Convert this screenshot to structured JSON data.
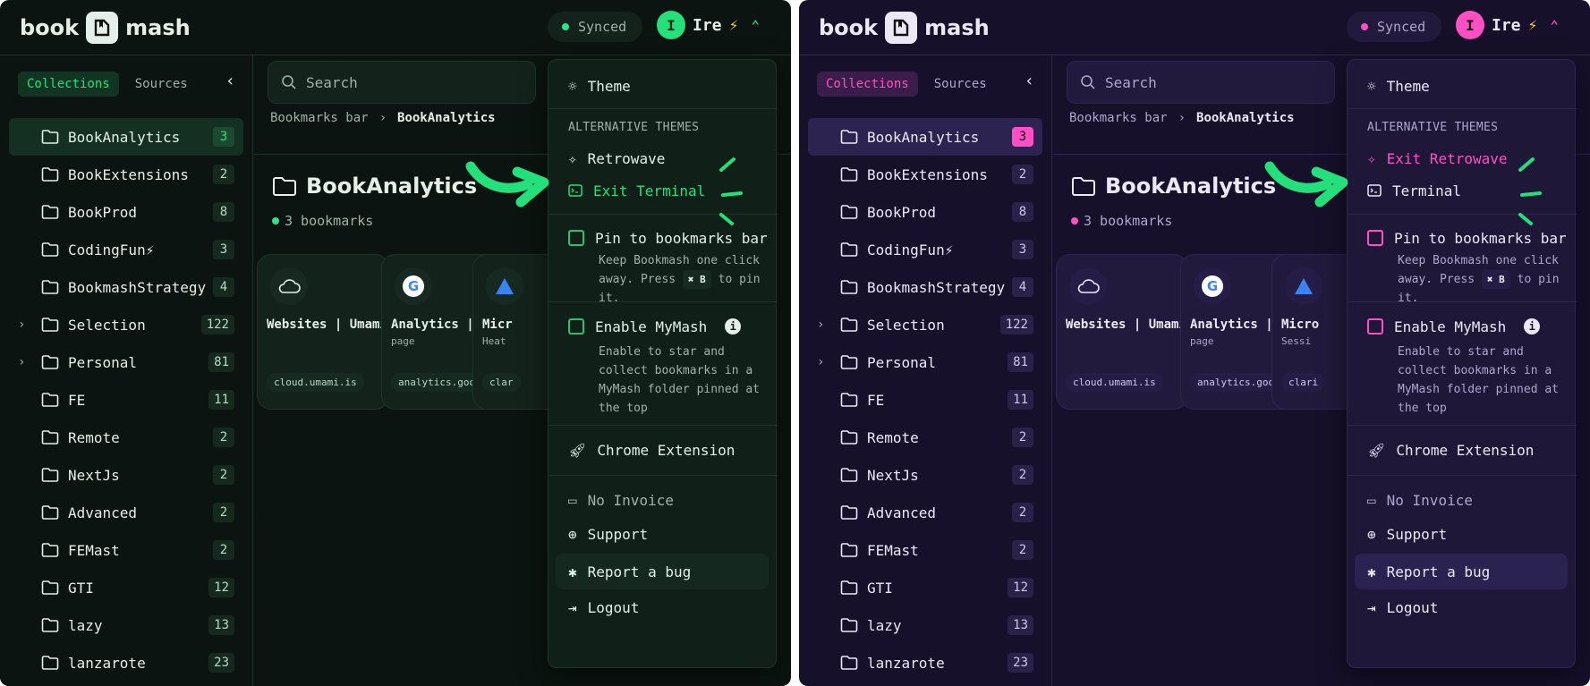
{
  "panels": [
    {
      "theme": "green",
      "brand": {
        "left": "book",
        "right": "mash"
      },
      "sync_label": "Synced",
      "user": {
        "initial": "I",
        "name": "Ire",
        "emoji": "⚡"
      },
      "sidebar": {
        "tabs": [
          "Collections",
          "Sources"
        ],
        "folders": [
          {
            "name": "BookAnalytics",
            "count": "3",
            "selected": true,
            "expandable": false
          },
          {
            "name": "BookExtensions",
            "count": "2",
            "selected": false,
            "expandable": false
          },
          {
            "name": "BookProd",
            "count": "8",
            "selected": false,
            "expandable": false
          },
          {
            "name": "CodingFun⚡",
            "count": "3",
            "selected": false,
            "expandable": false
          },
          {
            "name": "BookmashStrategy",
            "count": "4",
            "selected": false,
            "expandable": false
          },
          {
            "name": "Selection",
            "count": "122",
            "selected": false,
            "expandable": true
          },
          {
            "name": "Personal",
            "count": "81",
            "selected": false,
            "expandable": true
          },
          {
            "name": "FE",
            "count": "11",
            "selected": false,
            "expandable": false
          },
          {
            "name": "Remote",
            "count": "2",
            "selected": false,
            "expandable": false
          },
          {
            "name": "NextJs",
            "count": "2",
            "selected": false,
            "expandable": false
          },
          {
            "name": "Advanced",
            "count": "2",
            "selected": false,
            "expandable": false
          },
          {
            "name": "FEMast",
            "count": "2",
            "selected": false,
            "expandable": false
          },
          {
            "name": "GTI",
            "count": "12",
            "selected": false,
            "expandable": false
          },
          {
            "name": "lazy",
            "count": "13",
            "selected": false,
            "expandable": false
          },
          {
            "name": "lanzarote",
            "count": "23",
            "selected": false,
            "expandable": false
          }
        ]
      },
      "main": {
        "search_placeholder": "Search",
        "breadcrumb": [
          "Bookmarks bar",
          "BookAnalytics"
        ],
        "title": "BookAnalytics",
        "bookmark_count": "3 bookmarks",
        "cards": [
          {
            "title": "Websites | Umami",
            "subtitle": "",
            "url": "cloud.umami.is",
            "icon": "cloud-icon"
          },
          {
            "title": "Analytics | Ho",
            "subtitle": "page",
            "url": "analytics.google",
            "icon": "google-icon"
          },
          {
            "title": "Micr",
            "subtitle": "Heat",
            "url": "clar",
            "icon": "triangle-icon"
          }
        ]
      },
      "menu": {
        "theme_label": "Theme",
        "alt_themes_heading": "ALTERNATIVE THEMES",
        "alt_themes": [
          {
            "label": "Retrowave",
            "icon": "sparkle-icon",
            "active": false
          },
          {
            "label": "Exit Terminal",
            "icon": "terminal-icon",
            "active": true
          }
        ],
        "pin": {
          "label": "Pin to bookmarks bar",
          "desc_a": "Keep Bookmash one click away. Press",
          "kbd": "✖ B",
          "desc_b": "to pin it."
        },
        "mymash": {
          "label": "Enable MyMash",
          "desc": "Enable to star and collect bookmarks in a MyMash folder pinned at the top"
        },
        "chrome_ext": "Chrome Extension",
        "no_invoice": "No Invoice",
        "support": "Support",
        "report_bug": "Report a bug",
        "logout": "Logout"
      },
      "annotation_color": "#23e07a"
    },
    {
      "theme": "purple",
      "brand": {
        "left": "book",
        "right": "mash"
      },
      "sync_label": "Synced",
      "user": {
        "initial": "I",
        "name": "Ire",
        "emoji": "⚡"
      },
      "sidebar": {
        "tabs": [
          "Collections",
          "Sources"
        ],
        "folders": [
          {
            "name": "BookAnalytics",
            "count": "3",
            "selected": true,
            "expandable": false
          },
          {
            "name": "BookExtensions",
            "count": "2",
            "selected": false,
            "expandable": false
          },
          {
            "name": "BookProd",
            "count": "8",
            "selected": false,
            "expandable": false
          },
          {
            "name": "CodingFun⚡",
            "count": "3",
            "selected": false,
            "expandable": false
          },
          {
            "name": "BookmashStrategy",
            "count": "4",
            "selected": false,
            "expandable": false
          },
          {
            "name": "Selection",
            "count": "122",
            "selected": false,
            "expandable": true
          },
          {
            "name": "Personal",
            "count": "81",
            "selected": false,
            "expandable": true
          },
          {
            "name": "FE",
            "count": "11",
            "selected": false,
            "expandable": false
          },
          {
            "name": "Remote",
            "count": "2",
            "selected": false,
            "expandable": false
          },
          {
            "name": "NextJs",
            "count": "2",
            "selected": false,
            "expandable": false
          },
          {
            "name": "Advanced",
            "count": "2",
            "selected": false,
            "expandable": false
          },
          {
            "name": "FEMast",
            "count": "2",
            "selected": false,
            "expandable": false
          },
          {
            "name": "GTI",
            "count": "12",
            "selected": false,
            "expandable": false
          },
          {
            "name": "lazy",
            "count": "13",
            "selected": false,
            "expandable": false
          },
          {
            "name": "lanzarote",
            "count": "23",
            "selected": false,
            "expandable": false
          }
        ]
      },
      "main": {
        "search_placeholder": "Search",
        "breadcrumb": [
          "Bookmarks bar",
          "BookAnalytics"
        ],
        "title": "BookAnalytics",
        "bookmark_count": "3 bookmarks",
        "cards": [
          {
            "title": "Websites | Umami",
            "subtitle": "",
            "url": "cloud.umami.is",
            "icon": "cloud-icon"
          },
          {
            "title": "Analytics | Ho",
            "subtitle": "page",
            "url": "analytics.googl",
            "icon": "google-icon"
          },
          {
            "title": "Micro",
            "subtitle": "Sessi",
            "url": "clari",
            "icon": "triangle-icon"
          }
        ]
      },
      "menu": {
        "theme_label": "Theme",
        "alt_themes_heading": "ALTERNATIVE THEMES",
        "alt_themes": [
          {
            "label": "Exit Retrowave",
            "icon": "sparkle-icon",
            "active": true
          },
          {
            "label": "Terminal",
            "icon": "terminal-icon",
            "active": false
          }
        ],
        "pin": {
          "label": "Pin to bookmarks bar",
          "desc_a": "Keep Bookmash one click away. Press",
          "kbd": "✖ B",
          "desc_b": "to pin it."
        },
        "mymash": {
          "label": "Enable MyMash",
          "desc": "Enable to star and collect bookmarks in a MyMash folder pinned at the top"
        },
        "chrome_ext": "Chrome Extension",
        "no_invoice": "No Invoice",
        "support": "Support",
        "report_bug": "Report a bug",
        "logout": "Logout"
      },
      "annotation_color": "#23e07a"
    }
  ]
}
